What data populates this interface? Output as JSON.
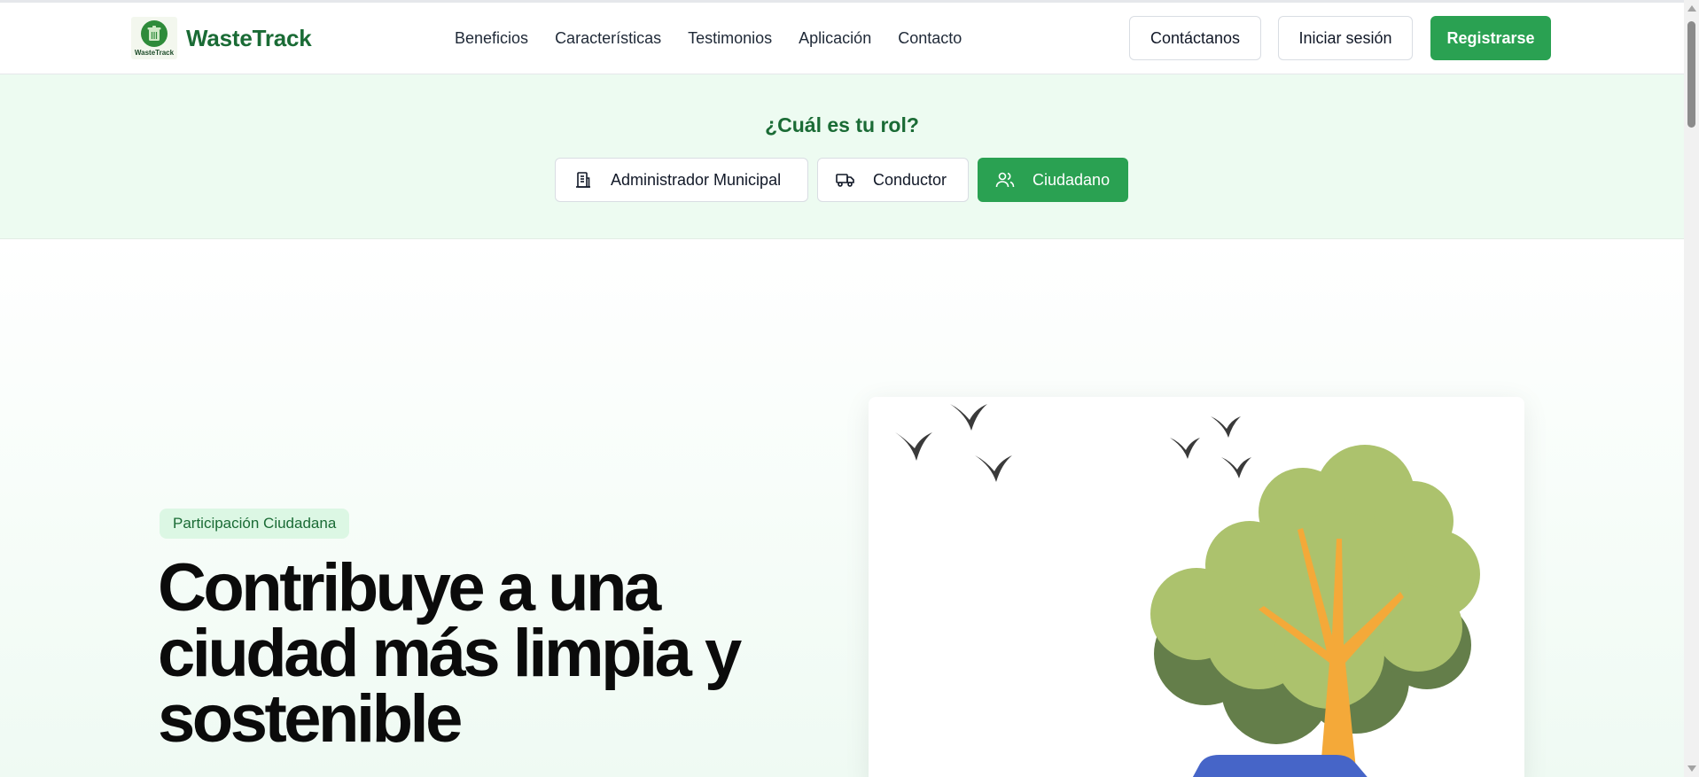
{
  "header": {
    "logo_small_text": "WasteTrack",
    "brand": "WasteTrack",
    "nav": [
      "Beneficios",
      "Características",
      "Testimonios",
      "Aplicación",
      "Contacto"
    ],
    "contact_button": "Contáctanos",
    "login_button": "Iniciar sesión",
    "register_button": "Registrarse"
  },
  "roles": {
    "title": "¿Cuál es tu rol?",
    "options": [
      {
        "label": "Administrador Municipal",
        "icon": "building-icon",
        "active": false
      },
      {
        "label": "Conductor",
        "icon": "truck-icon",
        "active": false
      },
      {
        "label": "Ciudadano",
        "icon": "users-icon",
        "active": true
      }
    ]
  },
  "hero": {
    "tag": "Participación Ciudadana",
    "headline_line1": "Contribuye a una",
    "headline_line2": "ciudad más limpia y",
    "headline_line3": "sostenible"
  },
  "colors": {
    "primary_green": "#2aa152",
    "brand_dark_green": "#1a6b35",
    "band_bg": "#edfbf1",
    "tag_bg": "#dcf7e4"
  }
}
